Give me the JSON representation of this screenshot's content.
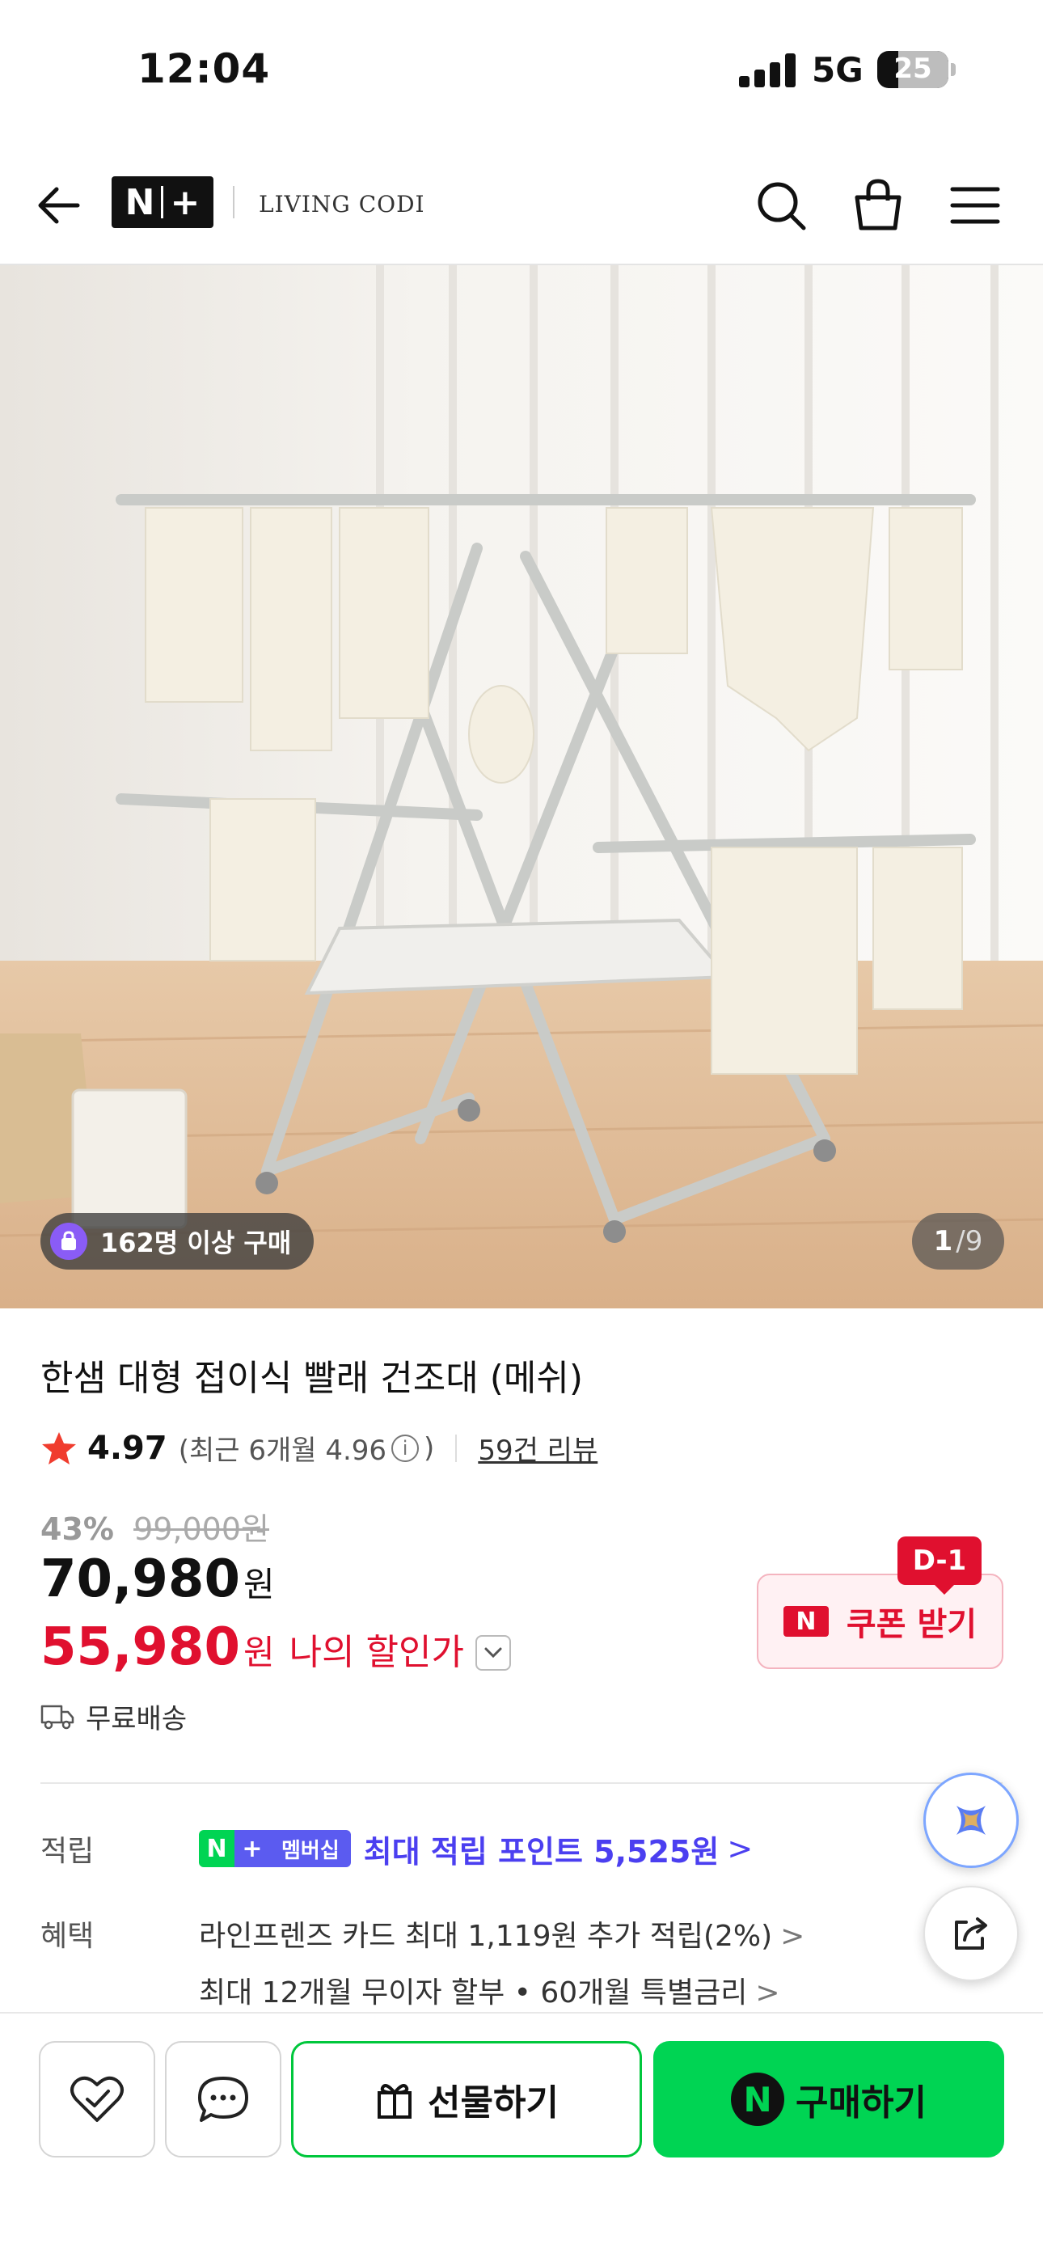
{
  "status_bar": {
    "time": "12:04",
    "network": "5G",
    "battery": "25"
  },
  "nav": {
    "logo": "N+",
    "store_name": "LIVING CODI",
    "icons": [
      "back-arrow-icon",
      "search-icon",
      "cart-icon",
      "menu-icon"
    ]
  },
  "hero": {
    "buyers_badge": "162명 이상 구매",
    "page_current": "1",
    "page_total": "/9"
  },
  "product": {
    "title": "한샘 대형 접이식 빨래 건조대 (메쉬)",
    "rating": "4.97",
    "rating_recent": "(최근 6개월 4.96",
    "rating_close": ")",
    "review_count": "59건 리뷰",
    "discount_rate": "43%",
    "original_price": "99,000원",
    "price": "70,980",
    "price_unit": "원",
    "my_price": "55,980",
    "my_price_unit": "원",
    "my_price_label": "나의 할인가",
    "shipping": "무료배송"
  },
  "coupon": {
    "dday": "D-1",
    "label": "쿠폰 받기",
    "mark": "N"
  },
  "points": {
    "label": "적립",
    "badge_n": "N",
    "badge_plus": "+",
    "badge_membership": "멤버십",
    "text": "최대 적립 포인트 5,525원",
    "chevron": ">"
  },
  "benefits": {
    "label": "혜택",
    "lines": [
      "라인프렌즈 카드 최대 1,119원 추가 적립(2%)",
      "최대 12개월 무이자 할부 • 60개월 특별금리"
    ],
    "chevron": ">"
  },
  "bottom_bar": {
    "gift_label": "선물하기",
    "buy_label": "구매하기",
    "buy_mark": "N"
  },
  "colors": {
    "price_red": "#e0102f",
    "naver_green": "#00d453",
    "point_purple": "#4b3ff0"
  }
}
